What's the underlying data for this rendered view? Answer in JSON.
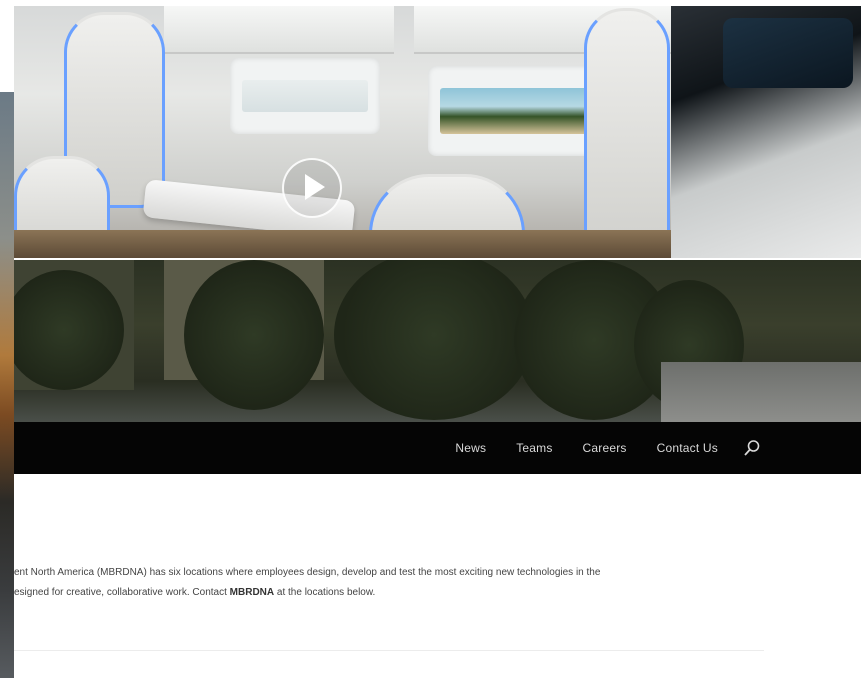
{
  "hero": {
    "video_play_label": "Play video"
  },
  "nav": {
    "items": [
      "News",
      "Teams",
      "Careers",
      "Contact Us"
    ]
  },
  "content": {
    "paragraph_line1": "ent North America (MBRDNA) has six locations where employees design, develop and test the most exciting new technologies in the",
    "paragraph_line2_a": "esigned for creative, collaborative work. Contact ",
    "paragraph_line2_b": "MBRDNA",
    "paragraph_line2_c": " at the locations below."
  }
}
